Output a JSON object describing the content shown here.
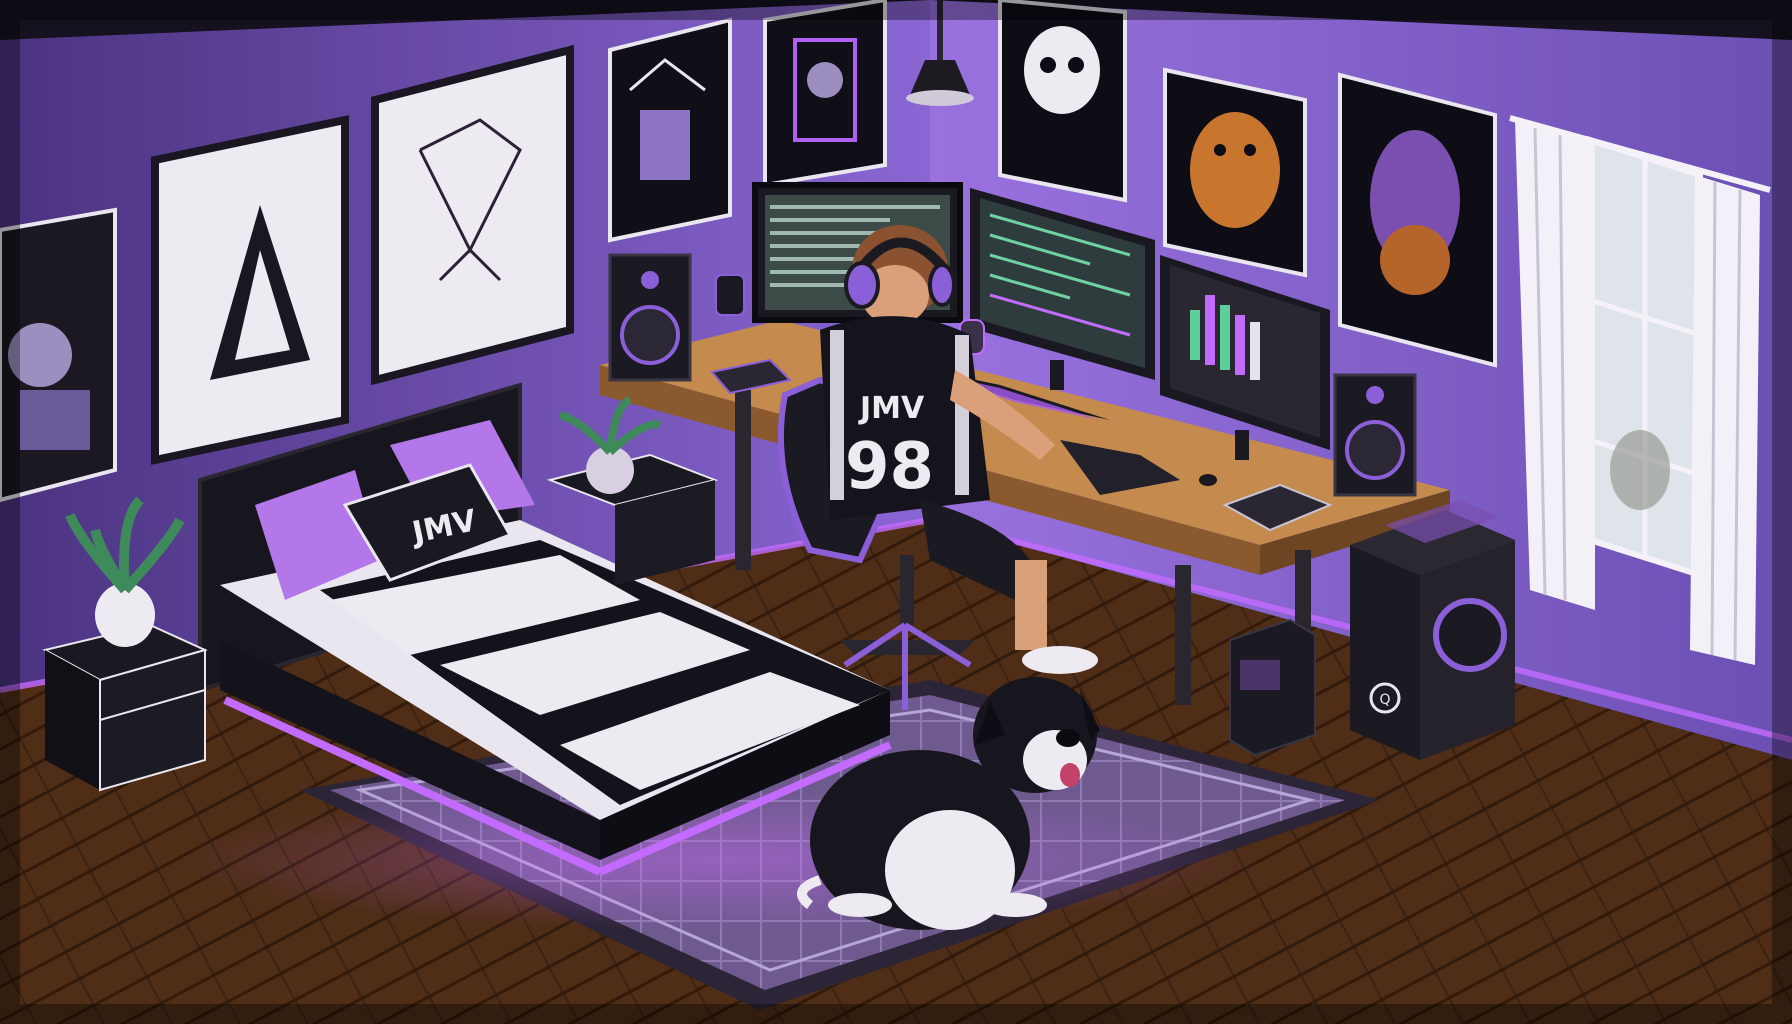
{
  "pillow": {
    "text": "JMV"
  },
  "jersey": {
    "name": "JMV",
    "number": "98"
  },
  "pc_case": {
    "logo": "Q"
  },
  "colors": {
    "wall": "#7c5bc7",
    "wall_dark": "#4a3385",
    "accent_purple": "#b04ff0",
    "floor_wood": "#6b3f22",
    "desk_wood": "#c48a4e",
    "black": "#14121a",
    "white": "#f1eef6"
  },
  "icons": [
    "headphones-icon",
    "keyboard-icon",
    "mouse-icon",
    "speaker-icon",
    "monitor-icon",
    "plant-icon",
    "pc-tower-icon"
  ]
}
